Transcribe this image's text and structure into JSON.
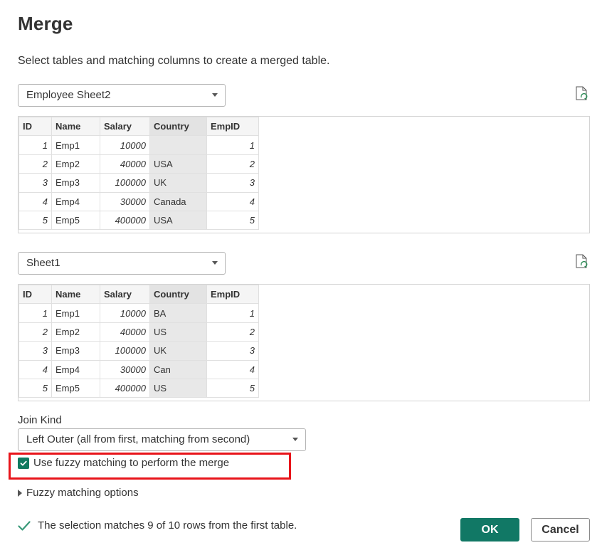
{
  "dialog": {
    "title": "Merge",
    "subtitle": "Select tables and matching columns to create a merged table."
  },
  "first_table": {
    "selected": "Employee Sheet2",
    "columns": [
      "ID",
      "Name",
      "Salary",
      "Country",
      "EmpID"
    ],
    "selected_column": "Country",
    "rows": [
      [
        "1",
        "Emp1",
        "10000",
        "",
        "1"
      ],
      [
        "2",
        "Emp2",
        "40000",
        "USA",
        "2"
      ],
      [
        "3",
        "Emp3",
        "100000",
        "UK",
        "3"
      ],
      [
        "4",
        "Emp4",
        "30000",
        "Canada",
        "4"
      ],
      [
        "5",
        "Emp5",
        "400000",
        "USA",
        "5"
      ]
    ]
  },
  "second_table": {
    "selected": "Sheet1",
    "columns": [
      "ID",
      "Name",
      "Salary",
      "Country",
      "EmpID"
    ],
    "selected_column": "Country",
    "rows": [
      [
        "1",
        "Emp1",
        "10000",
        "BA",
        "1"
      ],
      [
        "2",
        "Emp2",
        "40000",
        "US",
        "2"
      ],
      [
        "3",
        "Emp3",
        "100000",
        "UK",
        "3"
      ],
      [
        "4",
        "Emp4",
        "30000",
        "Can",
        "4"
      ],
      [
        "5",
        "Emp5",
        "400000",
        "US",
        "5"
      ]
    ]
  },
  "join": {
    "label": "Join Kind",
    "selected": "Left Outer (all from first, matching from second)"
  },
  "fuzzy": {
    "checked": true,
    "label": "Use fuzzy matching to perform the merge",
    "options_label": "Fuzzy matching options"
  },
  "status": {
    "text": "The selection matches 9 of 10 rows from the first table."
  },
  "buttons": {
    "ok": "OK",
    "cancel": "Cancel"
  },
  "colors": {
    "accent": "#117865",
    "highlight_box": "#e8141a",
    "selected_column_bg": "#e8e8e8"
  },
  "icons": {
    "refresh": "file-refresh-icon",
    "dropdown": "chevron-down-icon",
    "check": "check-icon",
    "expand": "triangle-right-icon"
  }
}
